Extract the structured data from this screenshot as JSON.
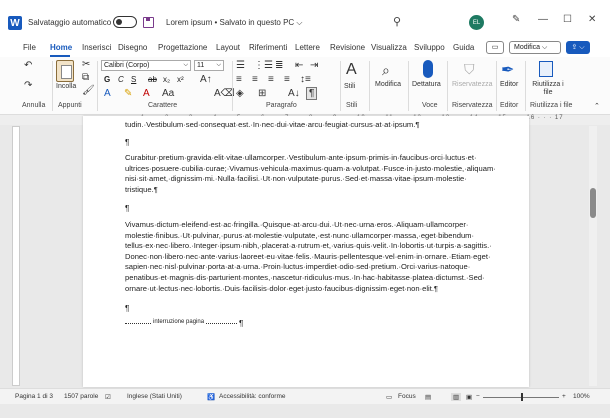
{
  "titlebar": {
    "app_glyph": "W",
    "autosave_label": "Salvataggio automatico",
    "document_title": "Lorem ipsum • Salvato in questo PC ⌵",
    "avatar_initials": "EL"
  },
  "menubar": {
    "tabs": [
      "File",
      "Home",
      "Inserisci",
      "Disegno",
      "Progettazione",
      "Layout",
      "Riferimenti",
      "Lettere",
      "Revisione",
      "Visualizza",
      "Sviluppo",
      "Guida"
    ],
    "active_tab": "Home",
    "edit_mode_label": "Modifica ⌵"
  },
  "ribbon": {
    "groups": {
      "annulla": "Annulla",
      "appunti": "Appunti",
      "carattere": "Carattere",
      "paragrafo": "Paragrafo",
      "stili": "Stili",
      "voce": "Voce",
      "riservatezza": "Riservatezza",
      "editor": "Editor",
      "riutilizza": "Riutilizza i file"
    },
    "paste_label": "Incolla",
    "font_name": "Calibri (Corpo)",
    "font_size": "11",
    "format_buttons": [
      "G",
      "C",
      "S",
      "ab",
      "x₂",
      "x²"
    ],
    "styles_label": "Stili",
    "modifica_label": "Modifica",
    "dettatura_label": "Dettatura",
    "riservatezza_label": "Riservatezza",
    "editor_label": "Editor",
    "riutilizza_label": "Riutilizza i file"
  },
  "document": {
    "top_cut_line": "tudin.·Vestibulum·sed·consequat·est.·In·nec·dui·vitae·arcu·feugiat·cursus·at·at·ipsum.¶",
    "pilcrow": "¶",
    "paragraph_1": [
      "Curabitur·pretium·gravida·elit·vitae·ullamcorper.·Vestibulum·ante·ipsum·primis·in·faucibus·orci·luctus·et·",
      "ultrices·posuere·cubilia·curae;·Vivamus·vehicula·maximus·quam·a·volutpat.·Fusce·in·justo·molestie,·aliquam·",
      "nisi·sit·amet,·dignissim·mi.·Nulla·facilisi.·Ut·non·vulputate·purus.·Sed·et·massa·vitae·ipsum·molestie·",
      "tristique.¶"
    ],
    "paragraph_2": [
      "Vivamus·dictum·eleifend·est·ac·fringilla.·Quisque·at·arcu·dui.·Ut·nec·urna·eros.·Aliquam·ullamcorper·",
      "molestie·finibus.·Ut·pulvinar,·purus·at·molestie·vulputate,·est·nunc·ullamcorper·massa,·eget·bibendum·",
      "tellus·ex·nec·libero.·Integer·ipsum·nibh,·placerat·a·rutrum·et,·varius·quis·velit.·In·lobortis·ut·turpis·a·sagittis.·",
      "Donec·non·libero·nec·ante·varius·laoreet·eu·vitae·felis.·Mauris·pellentesque·vel·enim·in·ornare.·Etiam·eget·",
      "sapien·nec·nisl·pulvinar·porta·at·a·urna.·Proin·luctus·imperdiet·odio·sed·pretium.·Orci·varius·natoque·",
      "penatibus·et·magnis·dis·parturient·montes,·nascetur·ridiculus·mus.·In·hac·habitasse·platea·dictumst.·Sed·",
      "ornare·ut·lectus·nec·lobortis.·Duis·facilisis·dolor·eget·justo·faucibus·dignissim·eget·non·elit.¶"
    ],
    "page_break_label": "interruzione pagina"
  },
  "statusbar": {
    "page_info": "Pagina 1 di 3",
    "word_count": "1507 parole",
    "language": "Inglese (Stati Uniti)",
    "accessibility": "Accessibilità: conforme",
    "focus_label": "Focus",
    "zoom_minus": "−",
    "zoom_plus": "+",
    "zoom_level": "100%"
  },
  "colors": {
    "accent": "#185abd",
    "avatar_bg": "#1e7a62"
  }
}
